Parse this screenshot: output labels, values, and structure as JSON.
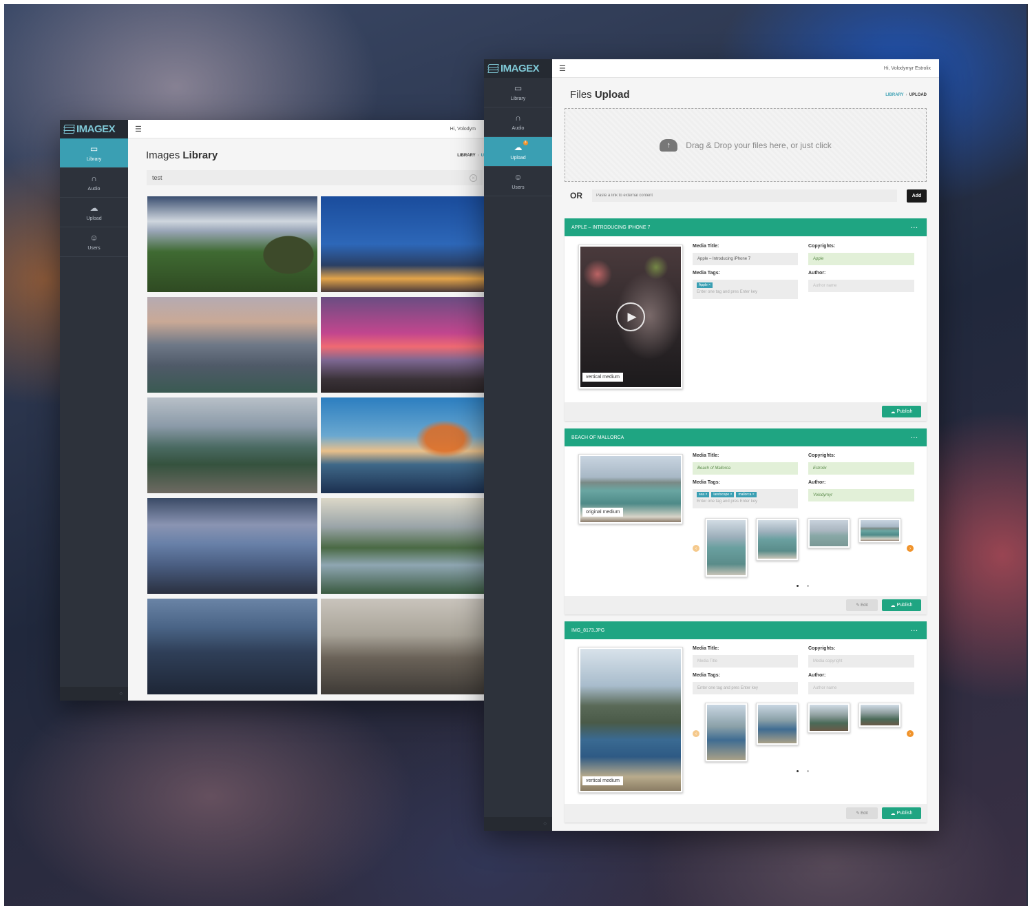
{
  "brand": {
    "name": "IMAGEX"
  },
  "nav": {
    "items": [
      {
        "label": "Library",
        "icon": "image-icon"
      },
      {
        "label": "Audio",
        "icon": "headphones-icon"
      },
      {
        "label": "Upload",
        "icon": "cloud-upload-icon",
        "badge": "3"
      },
      {
        "label": "Users",
        "icon": "users-icon"
      }
    ]
  },
  "user": {
    "greeting": "Hi, Volodymyr Estrolix",
    "greeting_truncated": "Hi, Volodym"
  },
  "library": {
    "title_light": "Images",
    "title_bold": "Library",
    "breadcrumb": {
      "current": "LIBRARY",
      "next": "U"
    },
    "search": {
      "value": "test"
    },
    "images": [
      {
        "name": "valley"
      },
      {
        "name": "kuala-lumpur"
      },
      {
        "name": "tokyo"
      },
      {
        "name": "sunset-beach"
      },
      {
        "name": "mountains"
      },
      {
        "name": "bridge"
      },
      {
        "name": "coast-road"
      },
      {
        "name": "misty-lake"
      },
      {
        "name": "new-york"
      },
      {
        "name": "old-town"
      }
    ]
  },
  "upload": {
    "title_light": "Files",
    "title_bold": "Upload",
    "breadcrumb": {
      "parent": "LIBRARY",
      "current": "UPLOAD"
    },
    "dropzone_text": "Drag & Drop your files here, or just click",
    "or_label": "OR",
    "link_placeholder": "Paste a link to external content",
    "add_label": "Add",
    "labels": {
      "media_title": "Media Title:",
      "copyrights": "Copyrights:",
      "media_tags": "Media Tags:",
      "author": "Author:",
      "tag_placeholder": "Enter one tag and pres Enter key",
      "author_placeholder": "Author name",
      "title_placeholder": "Media Title",
      "copyright_placeholder": "Media copyright",
      "edit": "Edit",
      "publish": "Publish",
      "menu": "···"
    },
    "cards": [
      {
        "header": "APPLE – INTRODUCING IPHONE 7",
        "size_tag": "vertical medium",
        "media_title": "Apple – Introducing iPhone 7",
        "copyrights": "Apple",
        "tags": [
          "Apple ×"
        ],
        "author": ""
      },
      {
        "header": "BEACH OF MALLORCA",
        "size_tag": "original medium",
        "media_title": "Beach of Mallorca",
        "copyrights": "Estrolix",
        "tags": [
          "sea ×",
          "landscape ×",
          "mallorca ×"
        ],
        "author": "Volodymyr"
      },
      {
        "header": "IMG_8173.JPG",
        "size_tag": "vertical medium",
        "media_title": "",
        "copyrights": "",
        "tags": [],
        "author": ""
      }
    ]
  }
}
